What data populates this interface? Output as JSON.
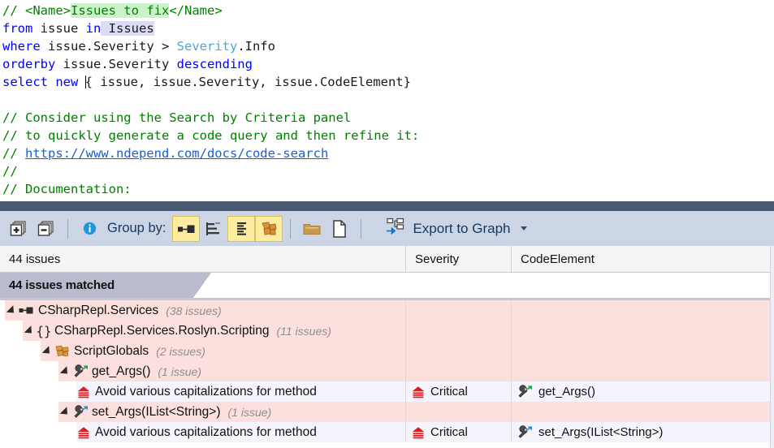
{
  "editor": {
    "lines": [
      {
        "id": "l1",
        "text": "// <Name>Issues to fix</Name>"
      },
      {
        "id": "l2",
        "text": "from issue in Issues"
      },
      {
        "id": "l3",
        "text": "where issue.Severity > Severity.Info"
      },
      {
        "id": "l4",
        "text": "orderby issue.Severity descending"
      },
      {
        "id": "l5",
        "text": "select new { issue, issue.Severity, issue.CodeElement}"
      },
      {
        "id": "l6",
        "text": ""
      },
      {
        "id": "l7",
        "text": "// Consider using the Search by Criteria panel"
      },
      {
        "id": "l8",
        "text": "// to quickly generate a code query and then refine it:"
      },
      {
        "id": "l9",
        "text": "// https://www.ndepend.com/docs/code-search"
      },
      {
        "id": "l10",
        "text": "//"
      },
      {
        "id": "l11",
        "text": "// Documentation:"
      }
    ],
    "tok": {
      "comment_slashes": "// ",
      "name_open": "<Name>",
      "name_value": "Issues to fix",
      "name_close": "</Name>",
      "from": "from",
      "issue": " issue ",
      "in": "in",
      "issues": " Issues",
      "where": "where",
      "where_rest": " issue.Severity > ",
      "severity_type": "Severity",
      "severity_info": ".Info",
      "orderby": "orderby",
      "orderby_rest": " issue.Severity ",
      "descending": "descending",
      "select": "select",
      "new": " new ",
      "select_rest": "{ issue, issue.Severity, issue.CodeElement}",
      "c_consider": "// Consider using the Search by Criteria panel",
      "c_quickly": "// to quickly generate a code query and then refine it:",
      "c_slash_pre": "// ",
      "c_link": "https://www.ndepend.com/docs/code-search",
      "c_empty": "//",
      "c_doc": "// Documentation:"
    }
  },
  "toolbar": {
    "expand_all_title": "Expand all",
    "collapse_all_title": "Collapse all",
    "group_by_label": "Group by:",
    "group_buttons": [
      {
        "name": "assembly",
        "active": true
      },
      {
        "name": "namespace-tree",
        "active": false
      },
      {
        "name": "namespace-flat",
        "active": true
      },
      {
        "name": "type",
        "active": true
      }
    ],
    "folder_title": "Folder",
    "file_title": "File",
    "export_label": "Export to Graph"
  },
  "grid": {
    "columns": [
      "44 issues",
      "Severity",
      "CodeElement"
    ],
    "banner": "44 issues matched",
    "rows": [
      {
        "kind": "group",
        "indent": 0,
        "icon": "assembly-icon",
        "name": "CSharpRepl.Services",
        "count": "(38 issues)",
        "severity": "",
        "code": "",
        "code_icon": ""
      },
      {
        "kind": "group",
        "indent": 1,
        "icon": "namespace-icon",
        "name": "CSharpRepl.Services.Roslyn.Scripting",
        "count": "(11 issues)",
        "severity": "",
        "code": "",
        "code_icon": ""
      },
      {
        "kind": "group",
        "indent": 2,
        "icon": "type-icon",
        "name": "ScriptGlobals",
        "count": "(2 issues)",
        "severity": "",
        "code": "",
        "code_icon": ""
      },
      {
        "kind": "group",
        "indent": 3,
        "icon": "method-getter-icon",
        "name": "get_Args()",
        "count": "(1 issue)",
        "severity": "",
        "code": "",
        "code_icon": ""
      },
      {
        "kind": "issue",
        "indent": 4,
        "icon": "critical-icon",
        "name": "Avoid various capitalizations for method",
        "count": "",
        "severity": "Critical",
        "code": "get_Args()",
        "code_icon": "method-getter-icon"
      },
      {
        "kind": "group",
        "indent": 3,
        "icon": "method-setter-icon",
        "name": "set_Args(IList<String>)",
        "count": "(1 issue)",
        "severity": "",
        "code": "",
        "code_icon": ""
      },
      {
        "kind": "issue",
        "indent": 4,
        "icon": "critical-icon",
        "name": "Avoid various capitalizations for method",
        "count": "",
        "severity": "Critical",
        "code": "set_Args(IList<String>)",
        "code_icon": "method-setter-icon"
      }
    ]
  },
  "colors": {
    "toolbar_bg": "#ccd5e6",
    "separator": "#4a5a73",
    "group_row": "#fbe0dd",
    "issue_row": "#f5f3fc",
    "banner": "#b8bccd",
    "active_button": "#fceda1",
    "keyword": "#0000ff",
    "comment": "#008000",
    "link": "#1a5fd0",
    "critical": "#e01b1b"
  }
}
